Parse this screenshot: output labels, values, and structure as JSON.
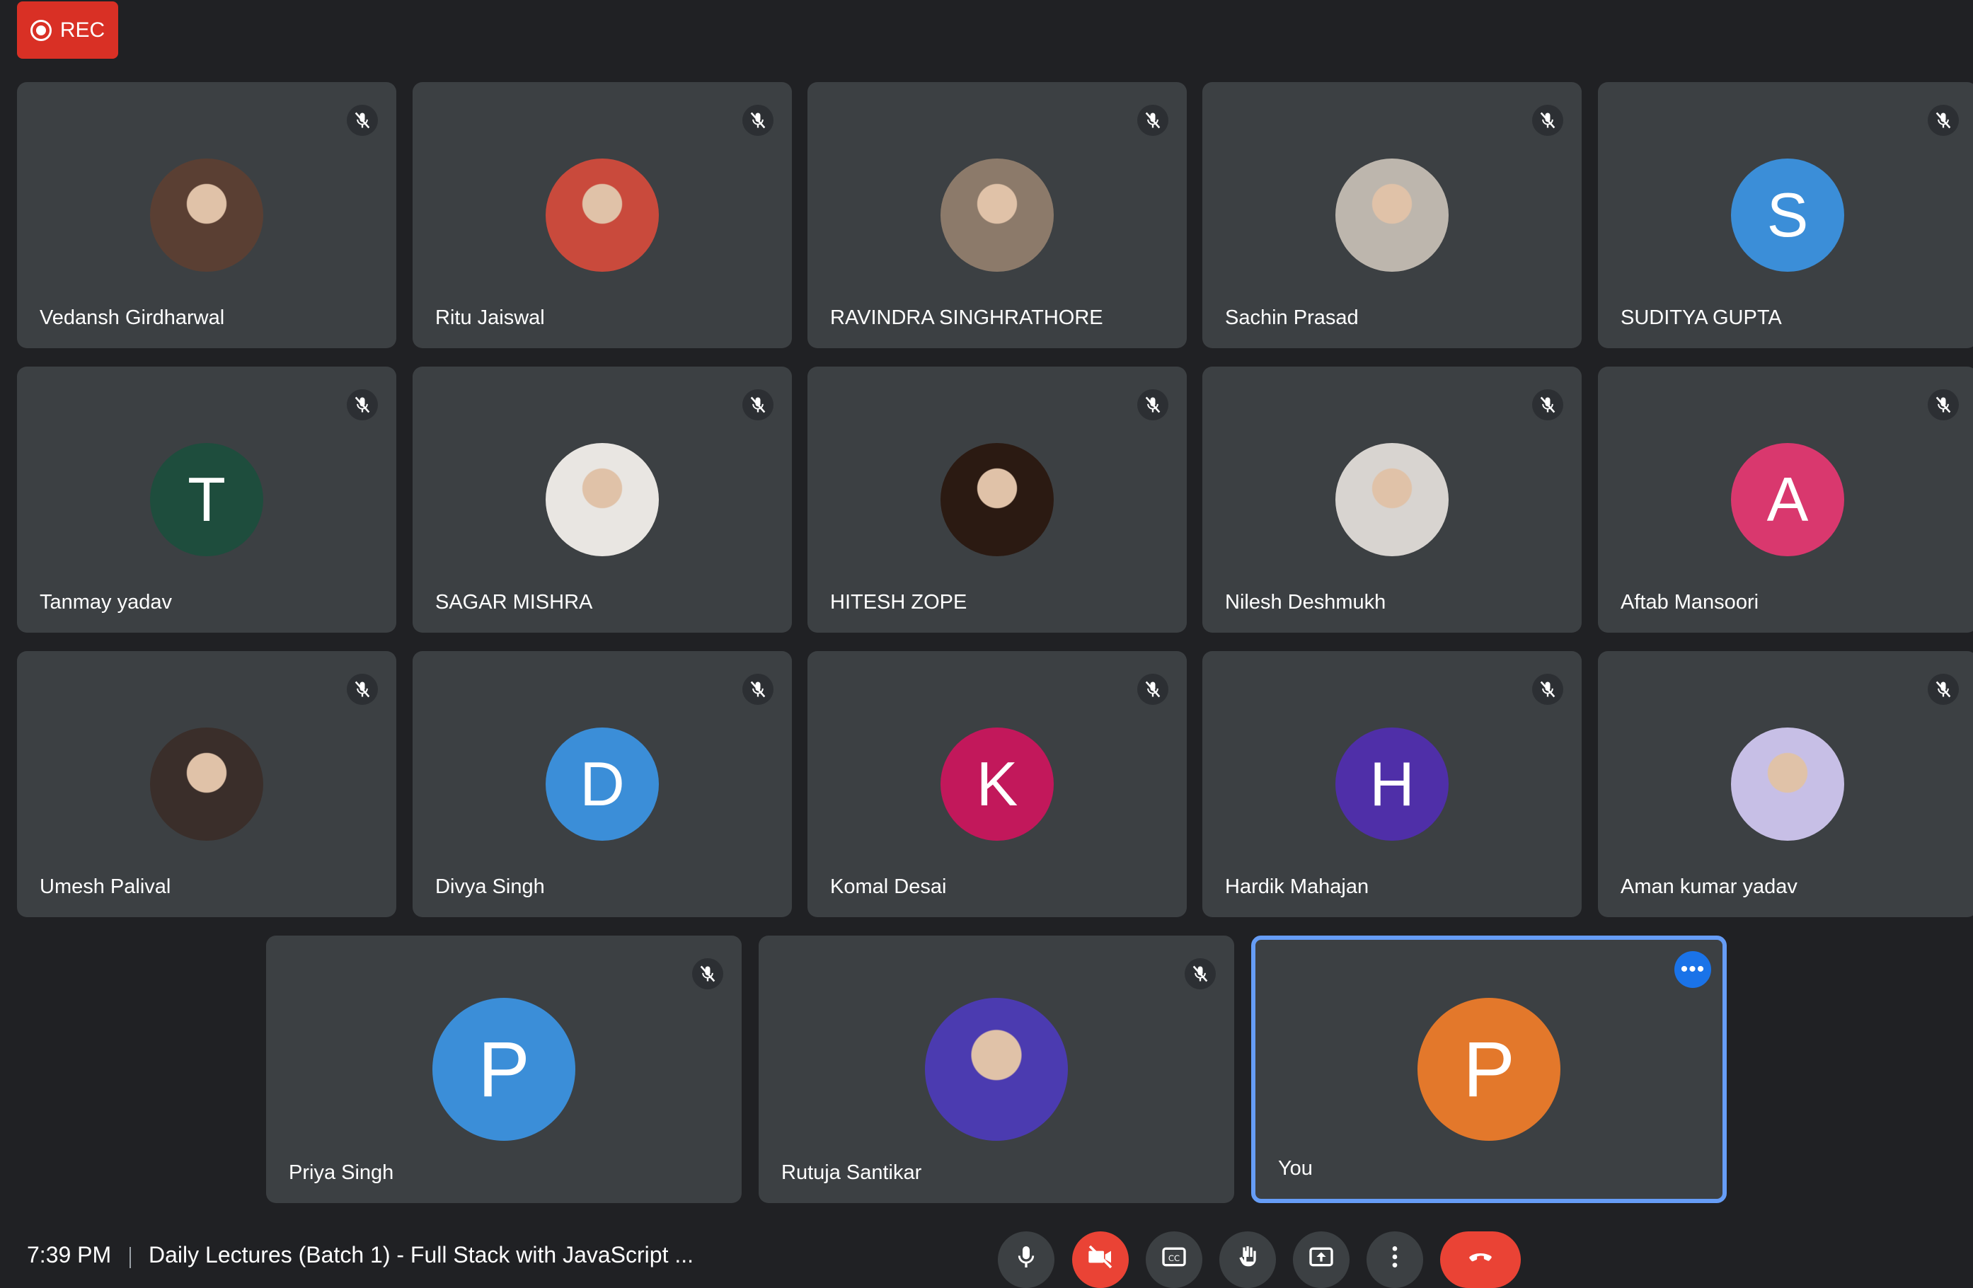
{
  "recording": {
    "label": "REC"
  },
  "participants": [
    {
      "name": "Vedansh Girdharwal",
      "avatar": "photo",
      "muted": true,
      "photo_tone": "#5a3f33"
    },
    {
      "name": "Ritu Jaiswal",
      "avatar": "photo",
      "muted": true,
      "photo_tone": "#c94a3c"
    },
    {
      "name": "RAVINDRA SINGHRATHORE",
      "avatar": "photo",
      "muted": true,
      "photo_tone": "#8c7a6a"
    },
    {
      "name": "Sachin Prasad",
      "avatar": "photo",
      "muted": true,
      "photo_tone": "#bdb6ad"
    },
    {
      "name": "SUDITYA GUPTA",
      "avatar": "letter",
      "letter": "S",
      "color": "#3b8ed8",
      "muted": true
    },
    {
      "name": "Tanmay yadav",
      "avatar": "letter",
      "letter": "T",
      "color": "#1e4d3d",
      "muted": true
    },
    {
      "name": "SAGAR MISHRA",
      "avatar": "photo",
      "muted": true,
      "photo_tone": "#e9e6e2"
    },
    {
      "name": "HITESH ZOPE",
      "avatar": "photo",
      "muted": true,
      "photo_tone": "#2b1a12"
    },
    {
      "name": "Nilesh Deshmukh",
      "avatar": "photo",
      "muted": true,
      "photo_tone": "#d8d4d0"
    },
    {
      "name": "Aftab Mansoori",
      "avatar": "letter",
      "letter": "A",
      "color": "#d9386e",
      "muted": true
    },
    {
      "name": "Umesh Palival",
      "avatar": "photo",
      "muted": true,
      "photo_tone": "#3a2e2a"
    },
    {
      "name": "Divya Singh",
      "avatar": "letter",
      "letter": "D",
      "color": "#3b8ed8",
      "muted": true
    },
    {
      "name": "Komal Desai",
      "avatar": "letter",
      "letter": "K",
      "color": "#c2185b",
      "muted": true
    },
    {
      "name": "Hardik Mahajan",
      "avatar": "letter",
      "letter": "H",
      "color": "#4f2fa8",
      "muted": true
    },
    {
      "name": "Aman kumar yadav",
      "avatar": "photo",
      "muted": true,
      "photo_tone": "#c7bfe6"
    },
    {
      "name": "Priya Singh",
      "avatar": "letter",
      "letter": "P",
      "color": "#3b8ed8",
      "muted": true
    },
    {
      "name": "Rutuja Santikar",
      "avatar": "photo",
      "muted": true,
      "photo_tone": "#4b3bb0"
    },
    {
      "name": "You",
      "avatar": "letter",
      "letter": "P",
      "color": "#e3782b",
      "muted": false,
      "self": true
    }
  ],
  "bottom_bar": {
    "time": "7:39 PM",
    "meeting_title": "Daily Lectures (Batch 1) - Full Stack with JavaScript ...",
    "controls": [
      "mic-icon",
      "camera-off-icon",
      "captions-icon",
      "raise-hand-icon",
      "present-icon",
      "more-options-icon",
      "end-call-icon"
    ]
  }
}
